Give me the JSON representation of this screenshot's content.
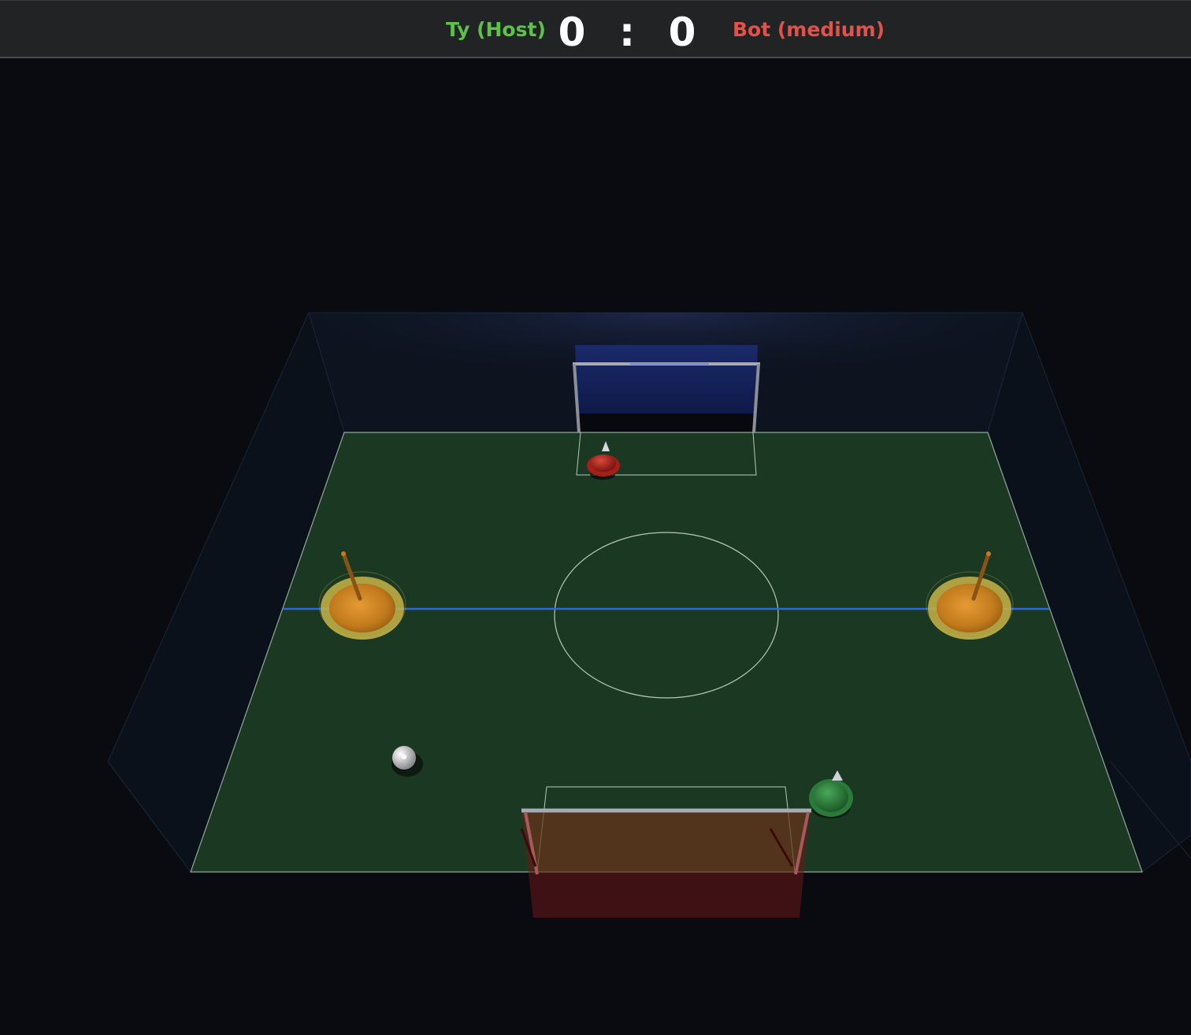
{
  "scoreboard": {
    "host_name": "Ty (Host)",
    "host_score": "0",
    "separator": ":",
    "bot_score": "0",
    "bot_name": "Bot (medium)",
    "colors": {
      "host": "#5cc24a",
      "bot": "#e0524a"
    }
  },
  "scene": {
    "field_color": "#1b3823",
    "far_goal_color": "#0f1b4a",
    "near_goal_color": "#6a1a17",
    "midline_color": "#2a6ad8",
    "bumper_color": "#d88a24",
    "icons": [
      "red-player-icon",
      "green-player-icon",
      "ball-icon",
      "goal-icon",
      "bumper-icon"
    ]
  }
}
